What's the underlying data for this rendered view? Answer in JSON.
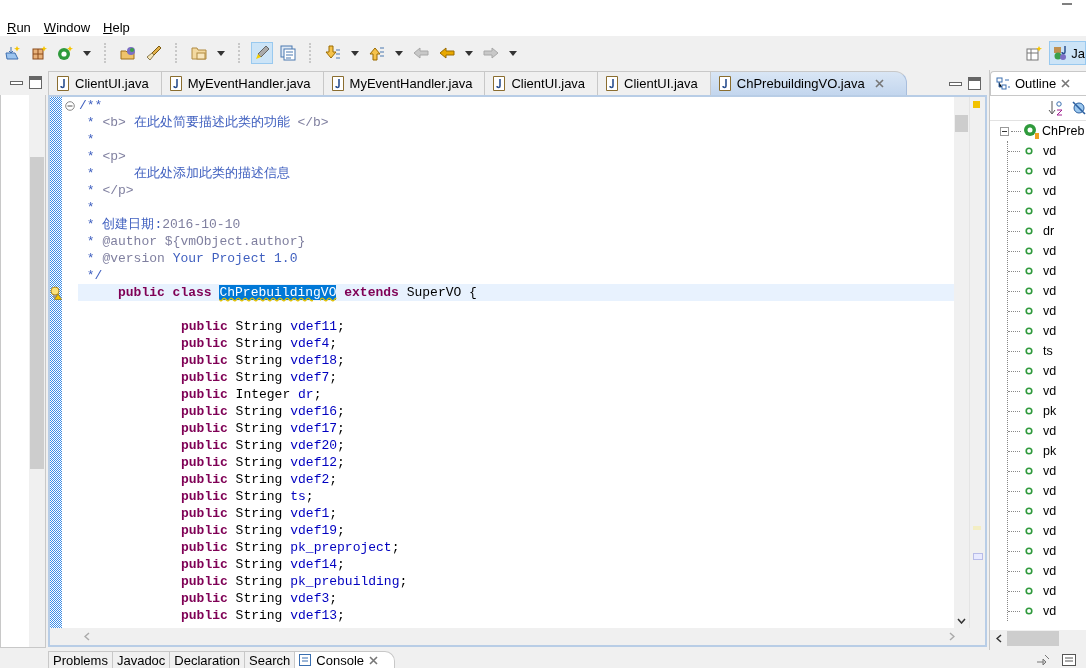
{
  "menu": [
    {
      "label": "Run"
    },
    {
      "label": "Window"
    },
    {
      "label": "Help"
    }
  ],
  "toolbar": {
    "mark_occurrences": {
      "selected": true
    },
    "navigation": [
      {
        "disabled": true
      },
      {
        "disabled": false
      },
      {
        "disabled": true
      }
    ],
    "perspective": {
      "label": "Ja",
      "selected": true
    }
  },
  "editor_tabs": [
    {
      "label": "ClientUI.java",
      "selected": false
    },
    {
      "label": "MyEventHandler.java",
      "selected": false
    },
    {
      "label": "MyEventHandler.java",
      "selected": false
    },
    {
      "label": "ClientUI.java",
      "selected": false
    },
    {
      "label": "ClientUI.java",
      "selected": false
    },
    {
      "label": "ChPrebuildingVO.java",
      "selected": true
    }
  ],
  "code": {
    "lines": [
      {
        "kind": "comment",
        "current": false,
        "foldable": true,
        "segments": [
          {
            "kind": "mark",
            "text": "/**"
          }
        ]
      },
      {
        "kind": "comment",
        "current": false,
        "segments": [
          {
            "kind": "mark",
            "text": " * "
          },
          {
            "kind": "tag",
            "text": "<b>"
          },
          {
            "kind": "text",
            "text": " 在此处简要描述此类的功能 "
          },
          {
            "kind": "tag",
            "text": "</b>"
          }
        ]
      },
      {
        "kind": "comment",
        "current": false,
        "segments": [
          {
            "kind": "mark",
            "text": " *"
          }
        ]
      },
      {
        "kind": "comment",
        "current": false,
        "segments": [
          {
            "kind": "mark",
            "text": " * "
          },
          {
            "kind": "tag",
            "text": "<p>"
          }
        ]
      },
      {
        "kind": "comment",
        "current": false,
        "segments": [
          {
            "kind": "mark",
            "text": " *     "
          },
          {
            "kind": "text",
            "text": "在此处添加此类的描述信息"
          }
        ]
      },
      {
        "kind": "comment",
        "current": false,
        "segments": [
          {
            "kind": "mark",
            "text": " * "
          },
          {
            "kind": "tag",
            "text": "</p>"
          }
        ]
      },
      {
        "kind": "comment",
        "current": false,
        "segments": [
          {
            "kind": "mark",
            "text": " *"
          }
        ]
      },
      {
        "kind": "comment",
        "current": false,
        "segments": [
          {
            "kind": "mark",
            "text": " * "
          },
          {
            "kind": "text",
            "text": "创建日期:"
          },
          {
            "kind": "tag",
            "text": "2016-10-10"
          }
        ]
      },
      {
        "kind": "comment",
        "current": false,
        "segments": [
          {
            "kind": "mark",
            "text": " * "
          },
          {
            "kind": "tag",
            "text": "@author ${vmObject.author}"
          }
        ]
      },
      {
        "kind": "comment",
        "current": false,
        "segments": [
          {
            "kind": "mark",
            "text": " * "
          },
          {
            "kind": "tag",
            "text": "@version"
          },
          {
            "kind": "text",
            "text": " Your Project 1.0"
          }
        ]
      },
      {
        "kind": "comment",
        "current": false,
        "segments": [
          {
            "kind": "mark",
            "text": " */"
          }
        ]
      },
      {
        "kind": "declaration",
        "current": true,
        "warning": true,
        "segments": [
          {
            "kind": "keyword",
            "text": "public class "
          },
          {
            "kind": "selection",
            "text": "ChPrebuildingVO"
          },
          {
            "kind": "keyword",
            "text": " extends"
          },
          {
            "kind": "plain",
            "text": " SuperVO {"
          }
        ]
      },
      {
        "kind": "blank",
        "current": false
      },
      {
        "kind": "field",
        "current": false,
        "segments": [
          {
            "kind": "keyword",
            "text": "public"
          },
          {
            "kind": "plain",
            "text": " String "
          },
          {
            "kind": "field",
            "text": "vdef11"
          },
          {
            "kind": "plain",
            "text": ";"
          }
        ]
      },
      {
        "kind": "field",
        "current": false,
        "segments": [
          {
            "kind": "keyword",
            "text": "public"
          },
          {
            "kind": "plain",
            "text": " String "
          },
          {
            "kind": "field",
            "text": "vdef4"
          },
          {
            "kind": "plain",
            "text": ";"
          }
        ]
      },
      {
        "kind": "field",
        "current": false,
        "segments": [
          {
            "kind": "keyword",
            "text": "public"
          },
          {
            "kind": "plain",
            "text": " String "
          },
          {
            "kind": "field",
            "text": "vdef18"
          },
          {
            "kind": "plain",
            "text": ";"
          }
        ]
      },
      {
        "kind": "field",
        "current": false,
        "segments": [
          {
            "kind": "keyword",
            "text": "public"
          },
          {
            "kind": "plain",
            "text": " String "
          },
          {
            "kind": "field",
            "text": "vdef7"
          },
          {
            "kind": "plain",
            "text": ";"
          }
        ]
      },
      {
        "kind": "field",
        "current": false,
        "segments": [
          {
            "kind": "keyword",
            "text": "public"
          },
          {
            "kind": "plain",
            "text": " Integer "
          },
          {
            "kind": "field",
            "text": "dr"
          },
          {
            "kind": "plain",
            "text": ";"
          }
        ]
      },
      {
        "kind": "field",
        "current": false,
        "segments": [
          {
            "kind": "keyword",
            "text": "public"
          },
          {
            "kind": "plain",
            "text": " String "
          },
          {
            "kind": "field",
            "text": "vdef16"
          },
          {
            "kind": "plain",
            "text": ";"
          }
        ]
      },
      {
        "kind": "field",
        "current": false,
        "segments": [
          {
            "kind": "keyword",
            "text": "public"
          },
          {
            "kind": "plain",
            "text": " String "
          },
          {
            "kind": "field",
            "text": "vdef17"
          },
          {
            "kind": "plain",
            "text": ";"
          }
        ]
      },
      {
        "kind": "field",
        "current": false,
        "segments": [
          {
            "kind": "keyword",
            "text": "public"
          },
          {
            "kind": "plain",
            "text": " String "
          },
          {
            "kind": "field",
            "text": "vdef20"
          },
          {
            "kind": "plain",
            "text": ";"
          }
        ]
      },
      {
        "kind": "field",
        "current": false,
        "segments": [
          {
            "kind": "keyword",
            "text": "public"
          },
          {
            "kind": "plain",
            "text": " String "
          },
          {
            "kind": "field",
            "text": "vdef12"
          },
          {
            "kind": "plain",
            "text": ";"
          }
        ]
      },
      {
        "kind": "field",
        "current": false,
        "segments": [
          {
            "kind": "keyword",
            "text": "public"
          },
          {
            "kind": "plain",
            "text": " String "
          },
          {
            "kind": "field",
            "text": "vdef2"
          },
          {
            "kind": "plain",
            "text": ";"
          }
        ]
      },
      {
        "kind": "field",
        "current": false,
        "segments": [
          {
            "kind": "keyword",
            "text": "public"
          },
          {
            "kind": "plain",
            "text": " String "
          },
          {
            "kind": "field",
            "text": "ts"
          },
          {
            "kind": "plain",
            "text": ";"
          }
        ]
      },
      {
        "kind": "field",
        "current": false,
        "segments": [
          {
            "kind": "keyword",
            "text": "public"
          },
          {
            "kind": "plain",
            "text": " String "
          },
          {
            "kind": "field",
            "text": "vdef1"
          },
          {
            "kind": "plain",
            "text": ";"
          }
        ]
      },
      {
        "kind": "field",
        "current": false,
        "segments": [
          {
            "kind": "keyword",
            "text": "public"
          },
          {
            "kind": "plain",
            "text": " String "
          },
          {
            "kind": "field",
            "text": "vdef19"
          },
          {
            "kind": "plain",
            "text": ";"
          }
        ]
      },
      {
        "kind": "field",
        "current": false,
        "segments": [
          {
            "kind": "keyword",
            "text": "public"
          },
          {
            "kind": "plain",
            "text": " String "
          },
          {
            "kind": "field",
            "text": "pk_preproject"
          },
          {
            "kind": "plain",
            "text": ";"
          }
        ]
      },
      {
        "kind": "field",
        "current": false,
        "segments": [
          {
            "kind": "keyword",
            "text": "public"
          },
          {
            "kind": "plain",
            "text": " String "
          },
          {
            "kind": "field",
            "text": "vdef14"
          },
          {
            "kind": "plain",
            "text": ";"
          }
        ]
      },
      {
        "kind": "field",
        "current": false,
        "segments": [
          {
            "kind": "keyword",
            "text": "public"
          },
          {
            "kind": "plain",
            "text": " String "
          },
          {
            "kind": "field",
            "text": "pk_prebuilding"
          },
          {
            "kind": "plain",
            "text": ";"
          }
        ]
      },
      {
        "kind": "field",
        "current": false,
        "segments": [
          {
            "kind": "keyword",
            "text": "public"
          },
          {
            "kind": "plain",
            "text": " String "
          },
          {
            "kind": "field",
            "text": "vdef3"
          },
          {
            "kind": "plain",
            "text": ";"
          }
        ]
      },
      {
        "kind": "field",
        "current": false,
        "segments": [
          {
            "kind": "keyword",
            "text": "public"
          },
          {
            "kind": "plain",
            "text": " String "
          },
          {
            "kind": "field",
            "text": "vdef13"
          },
          {
            "kind": "plain",
            "text": ";"
          }
        ]
      }
    ]
  },
  "outline": {
    "tab": {
      "label": "Outline",
      "selected": true
    },
    "tree": [
      {
        "label": "ChPreb",
        "expanded": true,
        "children": [
          {
            "label": "vd"
          },
          {
            "label": "vd"
          },
          {
            "label": "vd"
          },
          {
            "label": "vd"
          },
          {
            "label": "dr"
          },
          {
            "label": "vd"
          },
          {
            "label": "vd"
          },
          {
            "label": "vd"
          },
          {
            "label": "vd"
          },
          {
            "label": "vd"
          },
          {
            "label": "ts"
          },
          {
            "label": "vd"
          },
          {
            "label": "vd"
          },
          {
            "label": "pk"
          },
          {
            "label": "vd"
          },
          {
            "label": "pk"
          },
          {
            "label": "vd"
          },
          {
            "label": "vd"
          },
          {
            "label": "vd"
          },
          {
            "label": "vd"
          },
          {
            "label": "vd"
          },
          {
            "label": "vd"
          },
          {
            "label": "vd"
          },
          {
            "label": "vd"
          }
        ]
      }
    ]
  },
  "bottom_tabs": [
    {
      "label": "Problems",
      "selected": false
    },
    {
      "label": "Javadoc",
      "selected": false
    },
    {
      "label": "Declaration",
      "selected": false
    },
    {
      "label": "Search",
      "selected": false
    },
    {
      "label": "Console",
      "selected": true
    }
  ]
}
